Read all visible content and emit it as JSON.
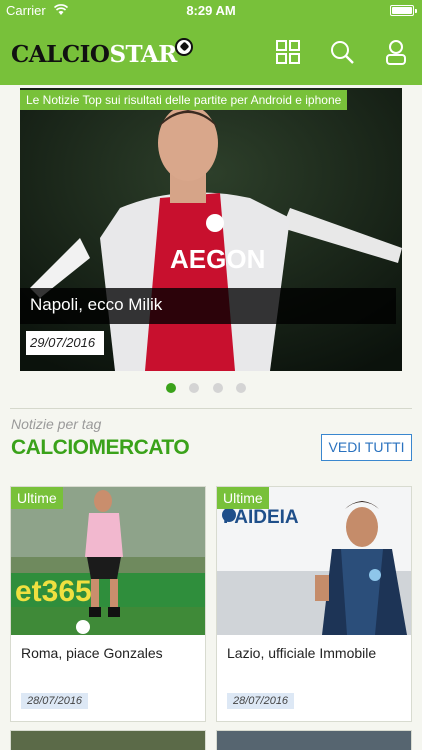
{
  "status_bar": {
    "carrier": "Carrier",
    "time": "8:29 AM"
  },
  "header": {
    "logo_main": "CALCIO",
    "logo_accent": "STAR",
    "icons": [
      "grid-icon",
      "search-icon",
      "user-icon"
    ]
  },
  "hero": {
    "tag": "Le Notizie Top sui risultati delle partite per Android e iphone",
    "title": "Napoli, ecco Milik",
    "date": "29/07/2016",
    "pager": {
      "total": 4,
      "active": 1
    }
  },
  "section": {
    "subtitle": "Notizie per tag",
    "title": "CALCIOMERCATO",
    "see_all_label": "VEDI TUTTI"
  },
  "cards": [
    {
      "badge": "Ultime",
      "title": "Roma, piace Gonzales",
      "date": "28/07/2016"
    },
    {
      "badge": "Ultime",
      "title": "Lazio, ufficiale Immobile",
      "date": "28/07/2016"
    }
  ],
  "colors": {
    "brand_green": "#78c13a",
    "section_green": "#3aa21a",
    "link_blue": "#2a72bf",
    "background": "#f5f6f0"
  }
}
